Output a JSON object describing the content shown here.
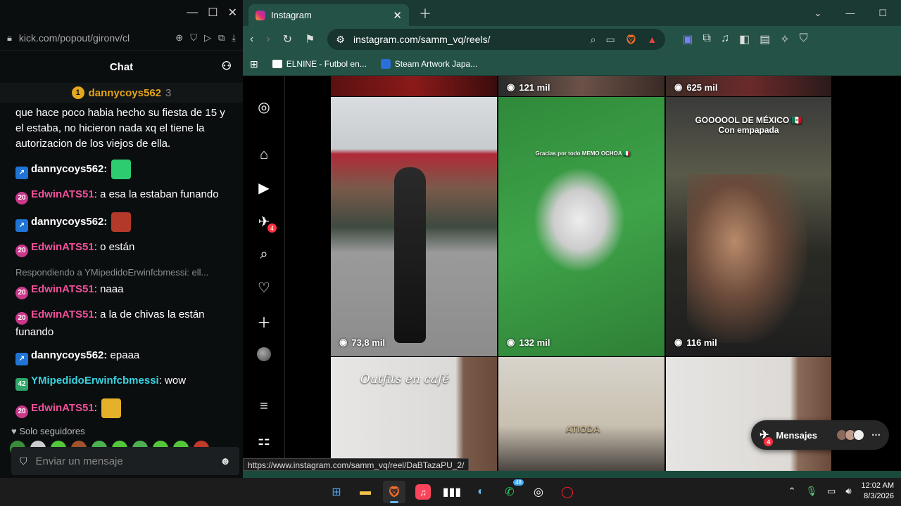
{
  "kick": {
    "url": "kick.com/popout/gironv/cl",
    "chat_title": "Chat",
    "pinned": {
      "user": "dannycoys562",
      "count": "3"
    },
    "messages": [
      {
        "id": "m0",
        "type": "text-only",
        "text": "que hace poco habia hecho su fiesta de 15 y el estaba, no hicieron nada xq el tiene la autorizacion de los viejos de ella."
      },
      {
        "id": "m1",
        "badge": "blue",
        "user": "dannycoys562:",
        "user_color": "white",
        "text": "",
        "emote": "#2ecc71"
      },
      {
        "id": "m2",
        "badge": "pink",
        "badge_text": "20",
        "user": "EdwinATS51",
        "user_color": "pink",
        "text": ": a esa la estaban funando"
      },
      {
        "id": "m3",
        "badge": "blue",
        "user": "dannycoys562:",
        "user_color": "white",
        "text": "",
        "emote": "#b33a2a"
      },
      {
        "id": "m4",
        "badge": "pink",
        "badge_text": "20",
        "user": "EdwinATS51",
        "user_color": "pink",
        "text": ": o están"
      },
      {
        "id": "m5",
        "reply": "Respondiendo a YMipedidoErwinfcbmessi: ell...",
        "badge": "pink",
        "badge_text": "20",
        "user": "EdwinATS51",
        "user_color": "pink",
        "text": ": naaa"
      },
      {
        "id": "m6",
        "badge": "pink",
        "badge_text": "20",
        "user": "EdwinATS51",
        "user_color": "pink",
        "text": ": a la de chivas la están funando"
      },
      {
        "id": "m7",
        "badge": "blue",
        "user": "dannycoys562:",
        "user_color": "white",
        "text": " epaaa"
      },
      {
        "id": "m8",
        "badge": "green",
        "badge_text": "42",
        "user": "YMipedidoErwinfcbmessi",
        "user_color": "cyan",
        "text": ": wow"
      },
      {
        "id": "m9",
        "badge": "pink",
        "badge_text": "20",
        "user": "EdwinATS51",
        "user_color": "pink",
        "text": ":",
        "emote": "#e5b12a"
      }
    ],
    "followers_only": "Solo seguidores",
    "input_placeholder": "Enviar un mensaje"
  },
  "browser": {
    "tab_title": "Instagram",
    "url": "instagram.com/samm_vq/reels/",
    "bookmarks": [
      "ELNINE - Futbol en...",
      "Steam Artwork Japa..."
    ],
    "status_url": "https://www.instagram.com/samm_vq/reel/DaBTazaPU_2/",
    "notification_count": "4"
  },
  "reels": {
    "top_row": [
      "121 mil",
      "625 mil"
    ],
    "cells": [
      {
        "id": "r1",
        "views": "73,8 mil",
        "caption": ""
      },
      {
        "id": "r2",
        "views": "132 mil",
        "caption": "Gracias por todo MEMO OCHOA 🇮🇹"
      },
      {
        "id": "r3",
        "views": "116 mil",
        "caption": "GOOOOOL DE MÉXICO 🇲🇽\nCon empapada"
      },
      {
        "id": "r4",
        "views": "",
        "caption": "Outfits en café"
      },
      {
        "id": "r5",
        "views": "",
        "caption": "ATIODA"
      },
      {
        "id": "r6",
        "views": "",
        "caption": ""
      }
    ]
  },
  "messages_bar": {
    "label": "Mensajes",
    "badge": "4"
  },
  "taskbar": {
    "time": "12:02 AM",
    "date": "8/3/2026",
    "whatsapp_badge": "48"
  }
}
